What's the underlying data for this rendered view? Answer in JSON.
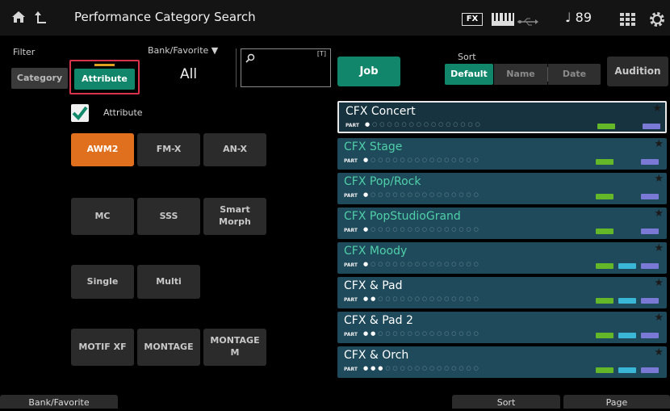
{
  "header": {
    "title": "Performance Category Search",
    "fx_label": "FX",
    "tempo": "89"
  },
  "filter": {
    "label": "Filter",
    "category_tab": "Category",
    "attribute_tab": "Attribute"
  },
  "bank": {
    "label": "Bank/Favorite",
    "value": "All"
  },
  "search": {
    "value": ""
  },
  "job_label": "Job",
  "sort": {
    "label": "Sort",
    "options": [
      "Default",
      "Name",
      "Date"
    ]
  },
  "audition_label": "Audition",
  "attribute": {
    "checkbox_label": "Attribute",
    "checked": true,
    "buttons": [
      [
        "AWM2",
        "FM-X",
        "AN-X"
      ],
      [
        "MC",
        "SSS",
        "Smart Morph"
      ],
      [
        "Single",
        "Multi"
      ],
      [
        "MOTIF XF",
        "MONTAGE",
        "MONTAGE M"
      ]
    ],
    "active": "AWM2"
  },
  "performances": [
    {
      "name": "CFX Concert",
      "parts": 1,
      "badges": [
        "green",
        "purple"
      ],
      "selected": true
    },
    {
      "name": "CFX Stage",
      "parts": 1,
      "badges": [
        "green",
        "purple"
      ],
      "selected": false
    },
    {
      "name": "CFX Pop/Rock",
      "parts": 1,
      "badges": [
        "green",
        "purple"
      ],
      "selected": false
    },
    {
      "name": "CFX PopStudioGrand",
      "parts": 1,
      "badges": [
        "green",
        "purple"
      ],
      "selected": false
    },
    {
      "name": "CFX Moody",
      "parts": 1,
      "badges": [
        "green",
        "cyan",
        "purple"
      ],
      "selected": false
    },
    {
      "name": "CFX & Pad",
      "parts": 2,
      "badges": [
        "green",
        "cyan",
        "purple"
      ],
      "selected": false
    },
    {
      "name": "CFX & Pad 2",
      "parts": 2,
      "badges": [
        "green",
        "cyan",
        "purple"
      ],
      "selected": false
    },
    {
      "name": "CFX & Orch",
      "parts": 3,
      "badges": [
        "green",
        "cyan",
        "purple"
      ],
      "selected": false
    }
  ],
  "part_label": "PART",
  "bottom": {
    "bank_favorite": "Bank/Favorite",
    "sort": "Sort",
    "page": "Page"
  },
  "colors": {
    "accent_orange": "#e0701e",
    "accent_green": "#11866a",
    "row_bg": "#1f4a5c",
    "row_text": "#4fd0a8",
    "selection_border": "#d8334b"
  }
}
